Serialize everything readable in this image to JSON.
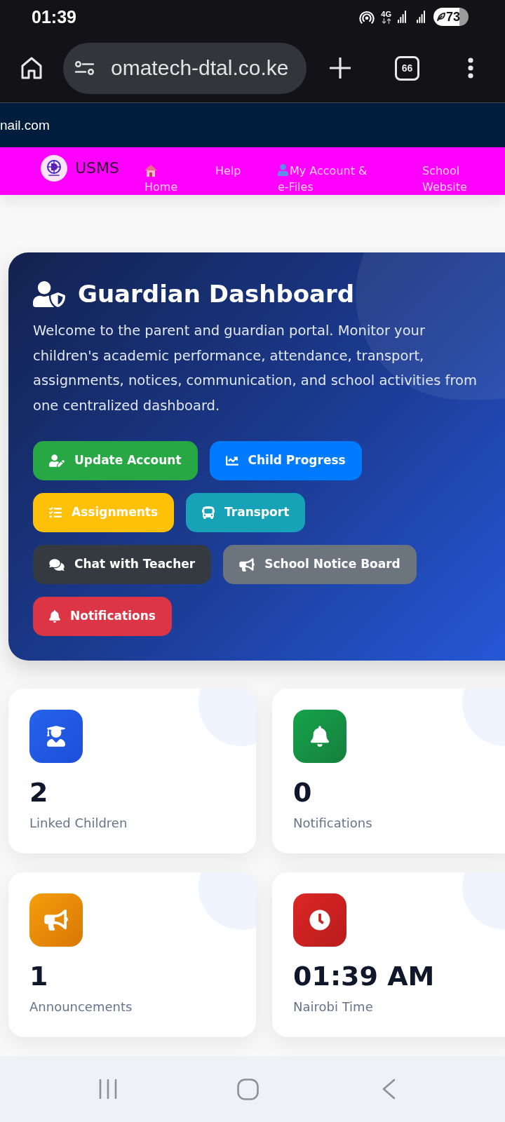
{
  "status_bar": {
    "time": "01:39",
    "network": "4G",
    "battery": "73"
  },
  "browser": {
    "url": "omatech-dtal.co.ke",
    "tab_count": "66"
  },
  "top_strip": {
    "text": "nail.com"
  },
  "navbar": {
    "brand": "USMS",
    "links": [
      {
        "label": "Home"
      },
      {
        "label": "Help"
      },
      {
        "label": "My Account & e-Files"
      },
      {
        "label": "School Website"
      }
    ]
  },
  "hero": {
    "title": "Guardian Dashboard",
    "text": "Welcome to the parent and guardian portal. Monitor your children's academic performance, attendance, transport, assignments, notices, communication, and school activities from one centralized dashboard.",
    "buttons": [
      {
        "label": "Update Account",
        "color": "#28a745"
      },
      {
        "label": "Child Progress",
        "color": "#007bff"
      },
      {
        "label": "Assignments",
        "color": "#ffc107"
      },
      {
        "label": "Transport",
        "color": "#17a2b8"
      },
      {
        "label": "Chat with Teacher",
        "color": "#343a40"
      },
      {
        "label": "School Notice Board",
        "color": "#6c757d"
      },
      {
        "label": "Notifications",
        "color": "#dc3545"
      }
    ]
  },
  "stats": [
    {
      "value": "2",
      "label": "Linked Children"
    },
    {
      "value": "0",
      "label": "Notifications"
    },
    {
      "value": "1",
      "label": "Announcements"
    },
    {
      "value": "01:39 AM",
      "label": "Nairobi Time"
    }
  ]
}
